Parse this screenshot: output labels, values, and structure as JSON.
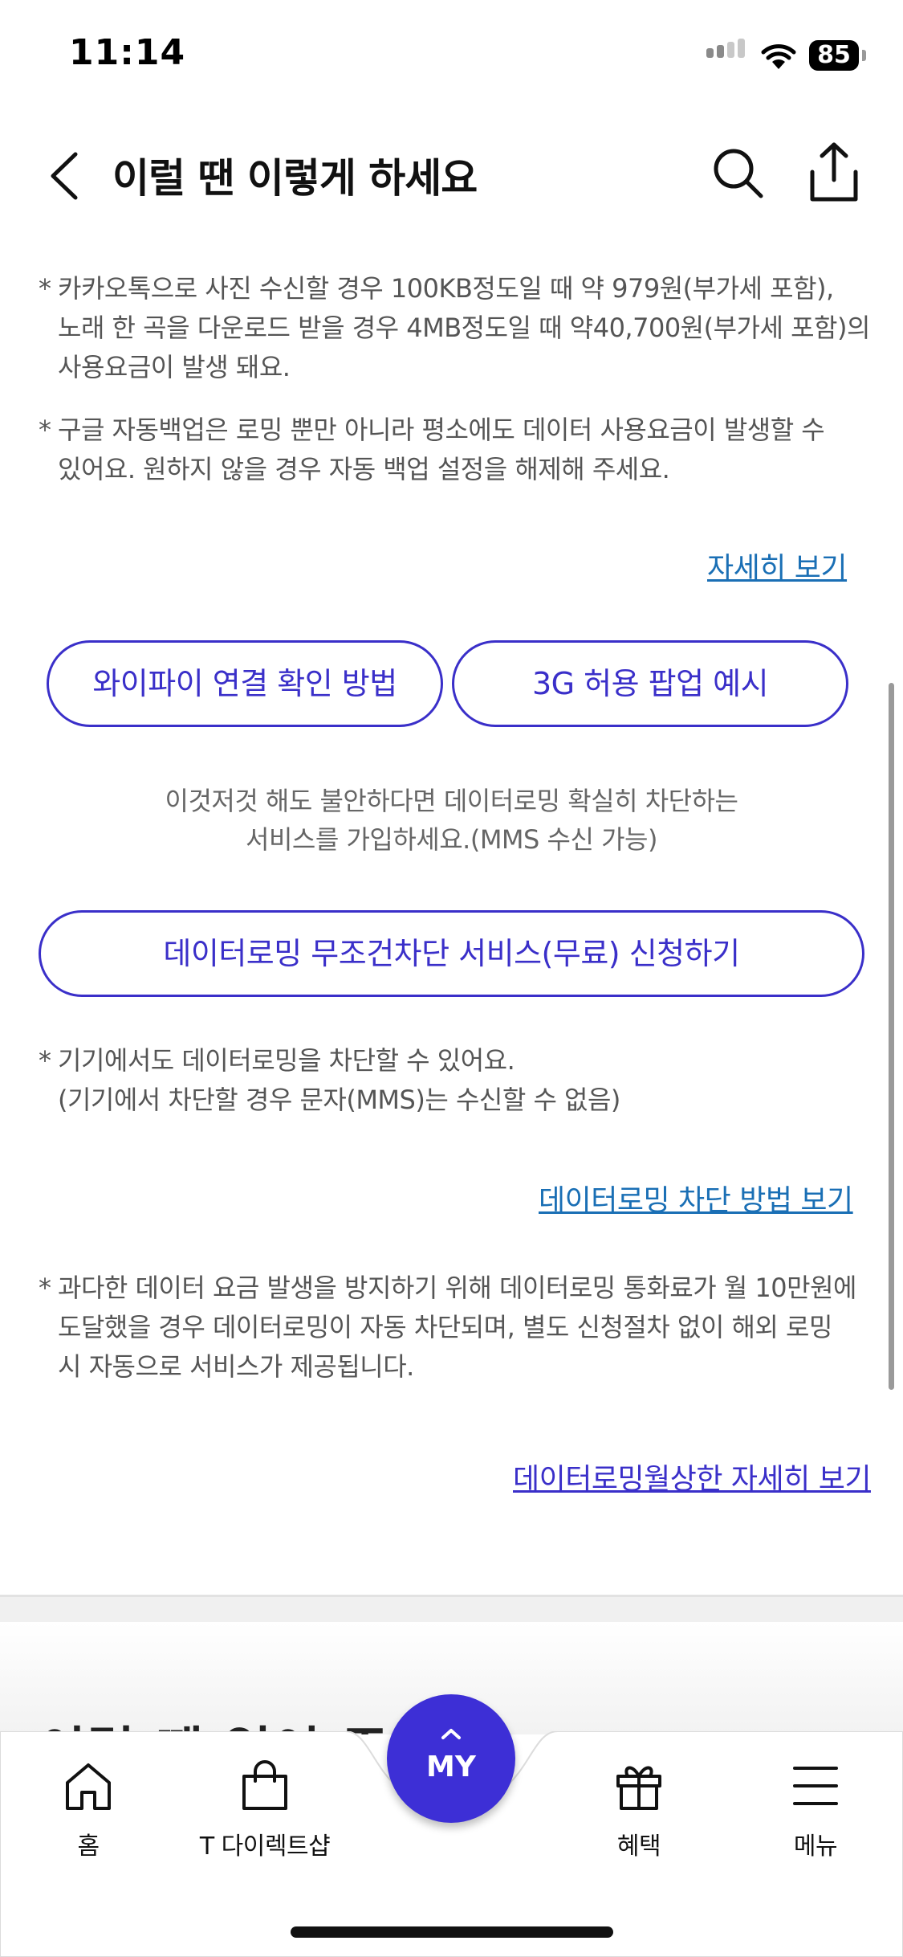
{
  "status_bar": {
    "time": "11:14",
    "battery": "85"
  },
  "header": {
    "title": "이럴 땐 이렇게 하세요"
  },
  "notes": {
    "kakao": [
      "카카오톡으로 사진 수신할 경우 100KB정도일 때 약 979원(부가세 포함),",
      "노래 한 곡을 다운로드 받을 경우 4MB정도일 때 약40,700원(부가세 포함)의",
      "사용요금이 발생 돼요."
    ],
    "google": [
      "구글 자동백업은 로밍 뿐만 아니라 평소에도 데이터 사용요금이 발생할 수",
      "있어요. 원하지 않을 경우 자동 백업 설정을 해제해 주세요."
    ],
    "device": [
      "기기에서도 데이터로밍을 차단할 수 있어요.",
      "(기기에서 차단할 경우 문자(MMS)는 수신할 수 없음)"
    ],
    "cap": [
      "과다한 데이터 요금 발생을 방지하기 위해 데이터로밍 통화료가 월 10만원에",
      "도달했을 경우 데이터로밍이 자동 차단되며, 별도 신청절차 없이 해외 로밍",
      "시 자동으로 서비스가 제공됩니다."
    ]
  },
  "star": "*",
  "links": {
    "more": "자세히 보기",
    "block_method": "데이터로밍 차단 방법 보기",
    "cap_more": "데이터로밍월상한 자세히 보기"
  },
  "buttons": {
    "wifi": "와이파이 연결 확인 방법",
    "popup_3g": "3G 허용 팝업 예시",
    "block_service": "데이터로밍 무조건차단 서비스(무료) 신청하기"
  },
  "promo": [
    "이것저것 해도 불안하다면 데이터로밍 확실히 차단하는",
    "서비스를 가입하세요.(MMS 수신 가능)"
  ],
  "next_section_title": "이럴 땐 없어 주세",
  "tab_bar": {
    "home": "홈",
    "shop": "T 다이렉트샵",
    "my": "MY",
    "benefits": "혜택",
    "menu": "메뉴"
  }
}
